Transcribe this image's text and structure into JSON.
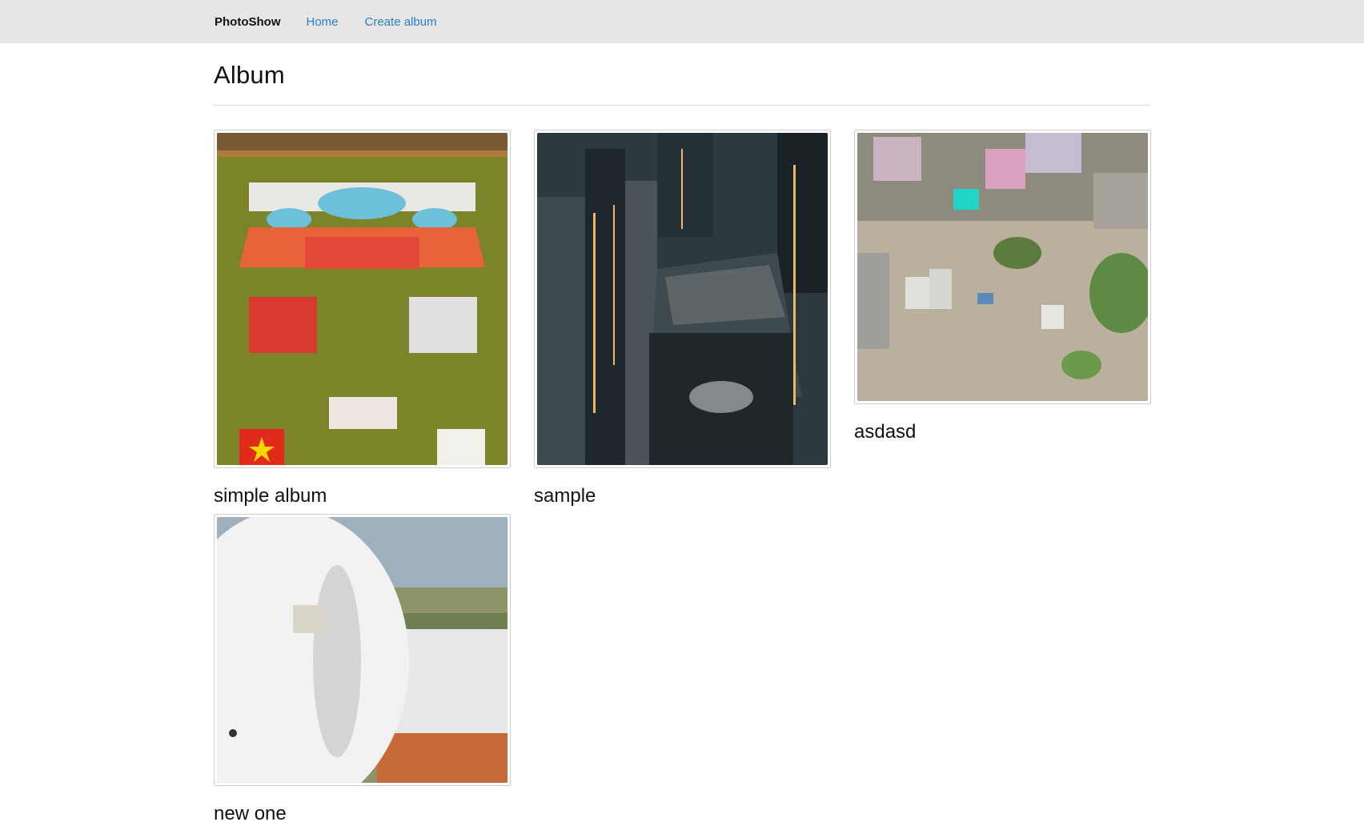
{
  "nav": {
    "brand": "PhotoShow",
    "links": [
      {
        "label": "Home"
      },
      {
        "label": "Create album"
      }
    ]
  },
  "page": {
    "title": "Album"
  },
  "albums": [
    {
      "title": "simple album",
      "image": "stadium-stage-aerial"
    },
    {
      "title": "sample",
      "image": "city-skyscrapers-aerial"
    },
    {
      "title": "asdasd",
      "image": "town-construction-aerial"
    },
    {
      "title": "new one",
      "image": "wind-turbine-landscape"
    }
  ]
}
